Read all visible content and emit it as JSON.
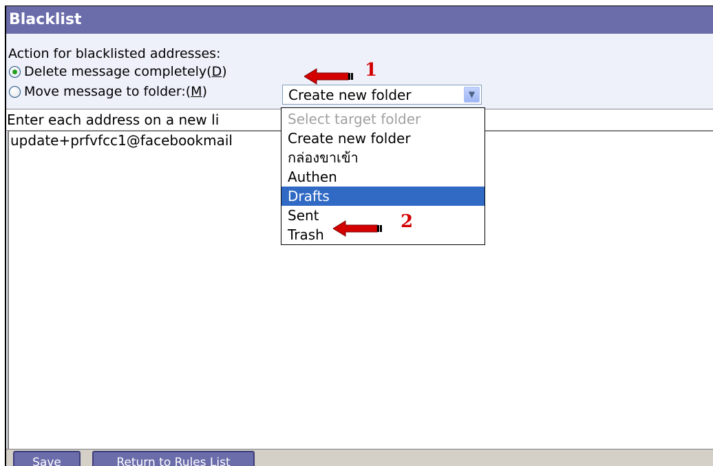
{
  "header": {
    "title": "Blacklist"
  },
  "action": {
    "label": "Action for blacklisted addresses:",
    "delete_option": {
      "text": "Delete message completely(",
      "accel": "D",
      "close": ")",
      "selected": true
    },
    "move_option": {
      "text": "Move message to folder:(",
      "accel": "M",
      "close": ")",
      "selected": false
    }
  },
  "folder_select": {
    "value": "Create new folder",
    "options": [
      {
        "label": "Select target folder",
        "state": "disabled"
      },
      {
        "label": "Create new folder",
        "state": "normal"
      },
      {
        "label": "กล่องขาเข้า",
        "state": "normal"
      },
      {
        "label": "Authen",
        "state": "normal"
      },
      {
        "label": "Drafts",
        "state": "selected"
      },
      {
        "label": "Sent",
        "state": "normal"
      },
      {
        "label": "Trash",
        "state": "normal"
      }
    ]
  },
  "address_list": {
    "label": "Enter each address on a new li",
    "content": "update+prfvfcc1@facebookmail"
  },
  "footer": {
    "save_label": "Save",
    "return_label": "Return to Rules List"
  },
  "annotations": {
    "marker_1": "1",
    "marker_2": "2"
  },
  "colors": {
    "header_bg": "#6b6dab",
    "panel_bg": "#eef0fa",
    "selection_bg": "#316ac5",
    "annotation_red": "#d40000"
  }
}
